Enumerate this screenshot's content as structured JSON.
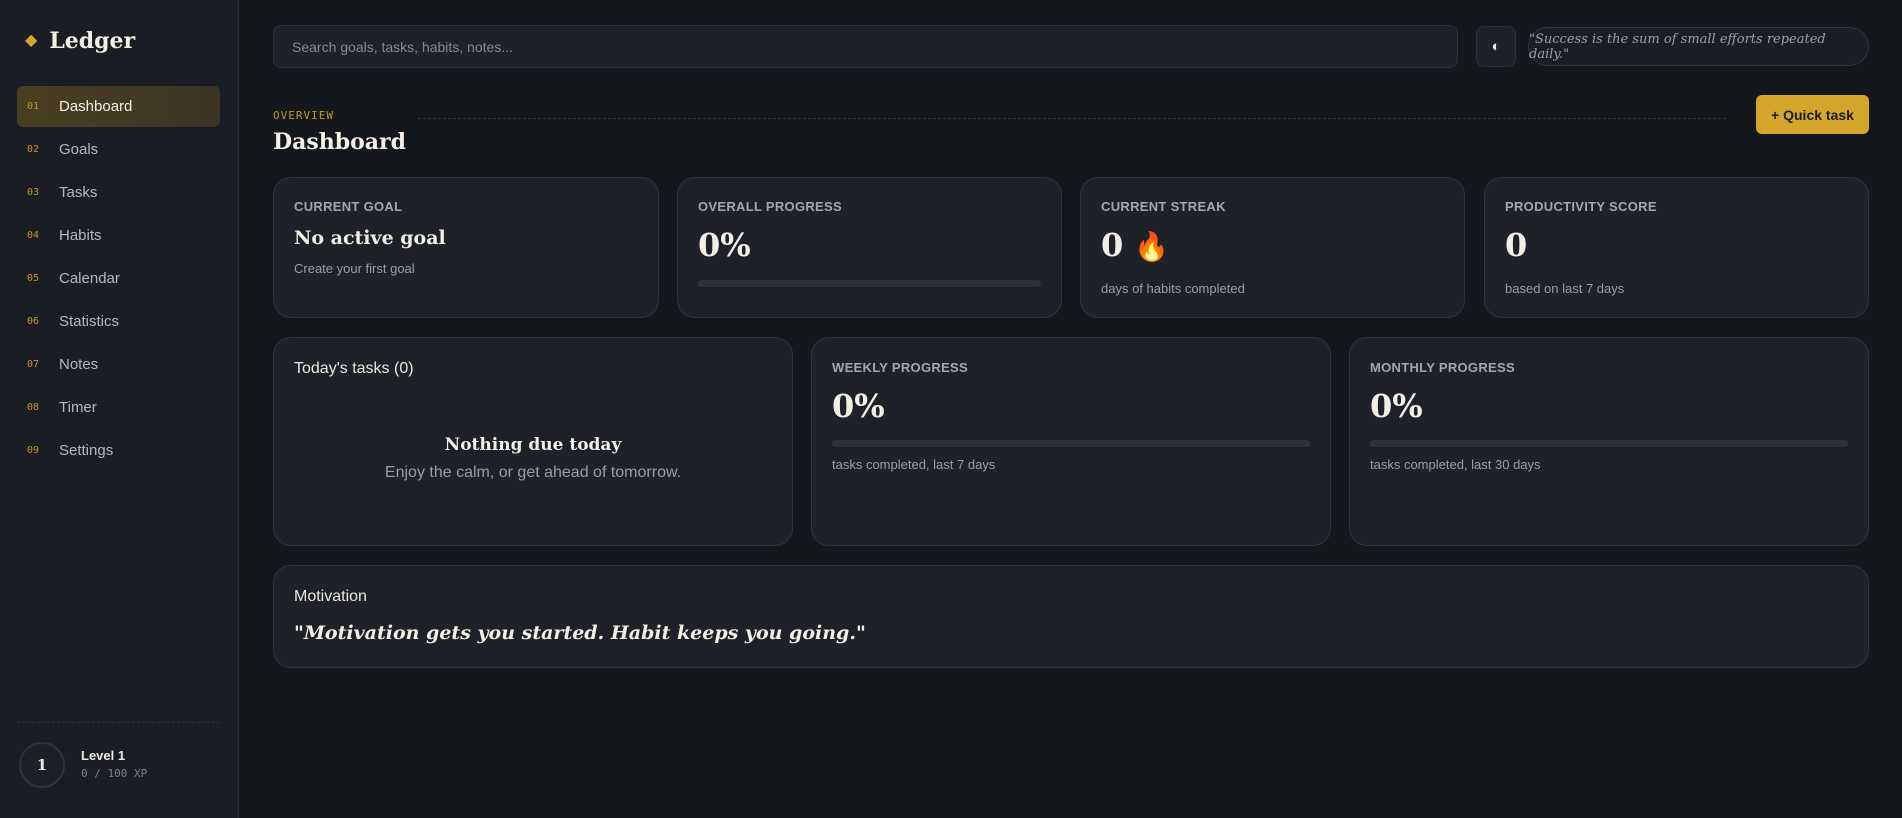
{
  "sidebar": {
    "brand": "Ledger",
    "items": [
      {
        "num": "01",
        "label": "Dashboard",
        "active": true
      },
      {
        "num": "02",
        "label": "Goals"
      },
      {
        "num": "03",
        "label": "Tasks"
      },
      {
        "num": "04",
        "label": "Habits"
      },
      {
        "num": "05",
        "label": "Calendar"
      },
      {
        "num": "06",
        "label": "Statistics"
      },
      {
        "num": "07",
        "label": "Notes"
      },
      {
        "num": "08",
        "label": "Timer"
      },
      {
        "num": "09",
        "label": "Settings"
      }
    ],
    "level": {
      "badge": "1",
      "title": "Level 1",
      "xp": "0 / 100 XP"
    }
  },
  "topbar": {
    "search_placeholder": "Search goals, tasks, habits, notes...",
    "theme_icon": "◐",
    "quote": "\"Success is the sum of small efforts repeated daily.\""
  },
  "header": {
    "overline": "OVERVIEW",
    "title": "Dashboard",
    "quick_task": "+ Quick task"
  },
  "cards": {
    "current_goal": {
      "label": "CURRENT GOAL",
      "title": "No active goal",
      "sub": "Create your first goal"
    },
    "overall_progress": {
      "label": "OVERALL PROGRESS",
      "value": "0%",
      "fraction": 0
    },
    "current_streak": {
      "label": "CURRENT STREAK",
      "value": "0",
      "icon": "🔥",
      "sub": "days of habits completed"
    },
    "productivity": {
      "label": "PRODUCTIVITY SCORE",
      "value": "0",
      "sub": "based on last 7 days"
    },
    "today_tasks": {
      "title": "Today's tasks (0)",
      "empty_title": "Nothing due today",
      "empty_sub": "Enjoy the calm, or get ahead of tomorrow."
    },
    "weekly": {
      "label": "WEEKLY PROGRESS",
      "value": "0%",
      "fraction": 0,
      "sub": "tasks completed, last 7 days"
    },
    "monthly": {
      "label": "MONTHLY PROGRESS",
      "value": "0%",
      "fraction": 0,
      "sub": "tasks completed, last 30 days"
    },
    "motivation": {
      "title": "Motivation",
      "quote": "\"Motivation gets you started. Habit keeps you going.\""
    }
  },
  "colors": {
    "accent": "#d4a72c",
    "background": "#14171c",
    "card": "#1e2228"
  }
}
